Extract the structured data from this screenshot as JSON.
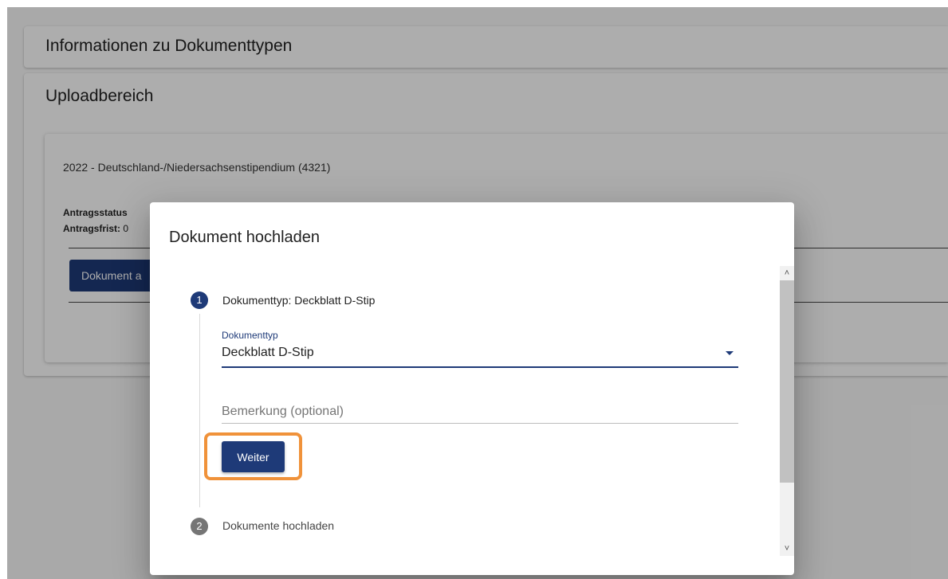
{
  "info_panel": {
    "title": "Informationen zu Dokumenttypen"
  },
  "upload_panel": {
    "title": "Uploadbereich",
    "card": {
      "program": "2022 - Deutschland-/Niedersachsenstipendium (4321)",
      "status_label": "Antragsstatus",
      "deadline_label": "Antragsfrist:",
      "deadline_value": "0",
      "document_button": "Dokument a"
    }
  },
  "dialog": {
    "title": "Dokument hochladen",
    "step1": {
      "number": "1",
      "label": "Dokumenttyp: Deckblatt D-Stip",
      "field_label": "Dokumenttyp",
      "selected_value": "Deckblatt D-Stip",
      "remark_placeholder": "Bemerkung (optional)",
      "next_button": "Weiter"
    },
    "step2": {
      "number": "2",
      "label": "Dokumente hochladen"
    },
    "scrollbar": {
      "up_icon": "˄",
      "down_icon": "˅"
    }
  },
  "colors": {
    "primary": "#1e3a78",
    "highlight": "#f0923a",
    "step_inactive": "#757575"
  }
}
